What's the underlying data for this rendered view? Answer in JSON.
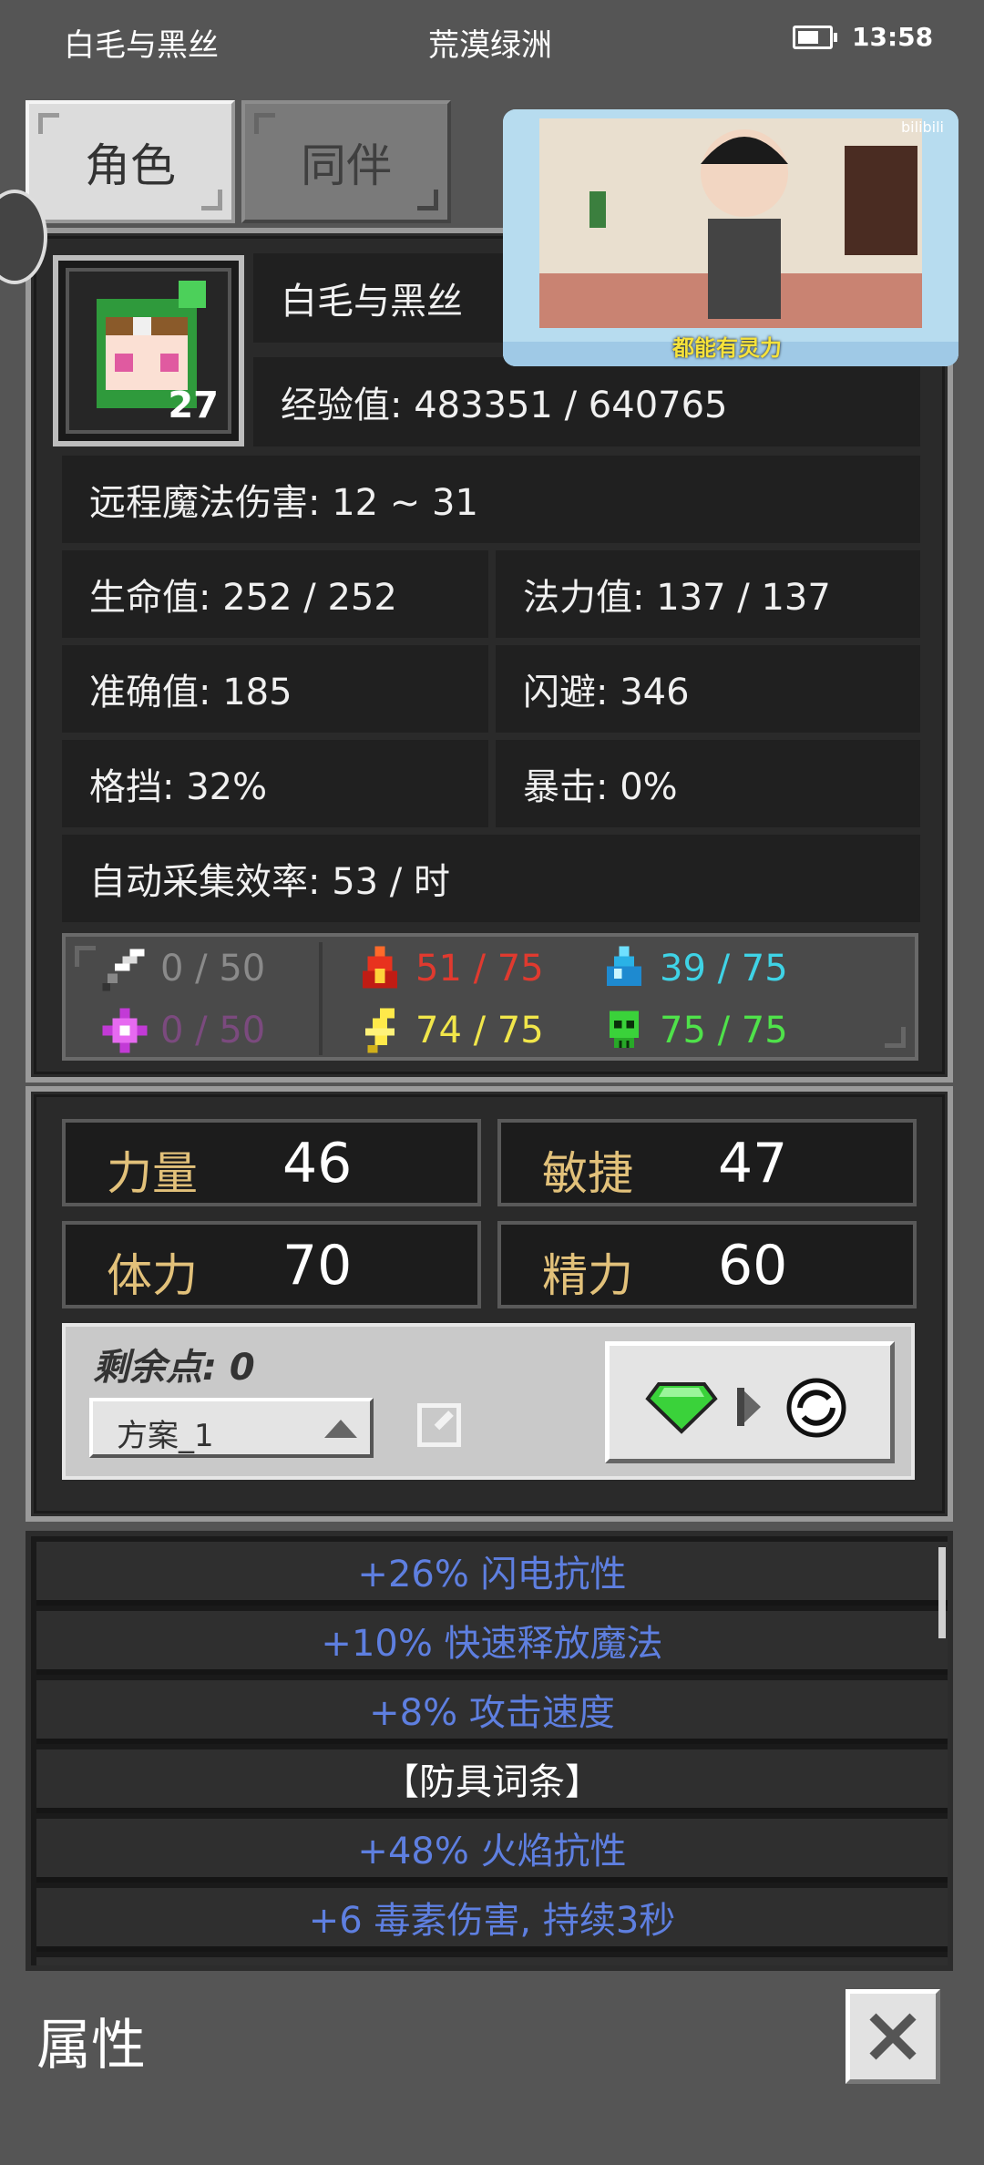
{
  "status_bar": {
    "left": "白毛与黑丝",
    "center": "荒漠绿洲",
    "time": "13:58"
  },
  "tabs": {
    "character": "角色",
    "companion": "同伴"
  },
  "video": {
    "caption": "都能有灵力",
    "watermark": "bilibili"
  },
  "character": {
    "name": "白毛与黑丝",
    "level": "27",
    "exp": "经验值: 483351 / 640765",
    "damage": "远程魔法伤害: 12 ~ 31",
    "hp": "生命值: 252 / 252",
    "mp": "法力值: 137 / 137",
    "accuracy": "准确值: 185",
    "dodge": "闪避: 346",
    "block": "格挡: 32%",
    "crit": "暴击: 0%",
    "gather": "自动采集效率: 53 / 时"
  },
  "resists": {
    "physical": {
      "value": "0 / 50",
      "icon": "sword-icon",
      "color": "#8a8a8a"
    },
    "fire": {
      "value": "51 / 75",
      "icon": "fire-icon",
      "color": "#e03a2f"
    },
    "water": {
      "value": "39 / 75",
      "icon": "water-drop-icon",
      "color": "#3fd3e6"
    },
    "arcane": {
      "value": "0 / 50",
      "icon": "arcane-star-icon",
      "color": "#7b4a7e"
    },
    "lightning": {
      "value": "74 / 75",
      "icon": "lightning-icon",
      "color": "#f1e64a"
    },
    "poison": {
      "value": "75 / 75",
      "icon": "poison-skull-icon",
      "color": "#4fe24a"
    }
  },
  "attributes": {
    "strength": {
      "label": "力量",
      "value": "46"
    },
    "agility": {
      "label": "敏捷",
      "value": "47"
    },
    "stamina": {
      "label": "体力",
      "value": "70"
    },
    "spirit": {
      "label": "精力",
      "value": "60"
    }
  },
  "points": {
    "remaining": "剩余点: 0",
    "plan": "方案_1"
  },
  "effects": [
    "+26% 闪电抗性",
    "+10% 快速释放魔法",
    "+8% 攻击速度",
    "【防具词条】",
    "+48% 火焰抗性",
    "+6 毒素伤害, 持续3秒"
  ],
  "footer": {
    "title": "属性"
  },
  "colors": {
    "effect_text": "#5e7fe0",
    "attr_label": "#e2c17a",
    "background": "#555555"
  }
}
